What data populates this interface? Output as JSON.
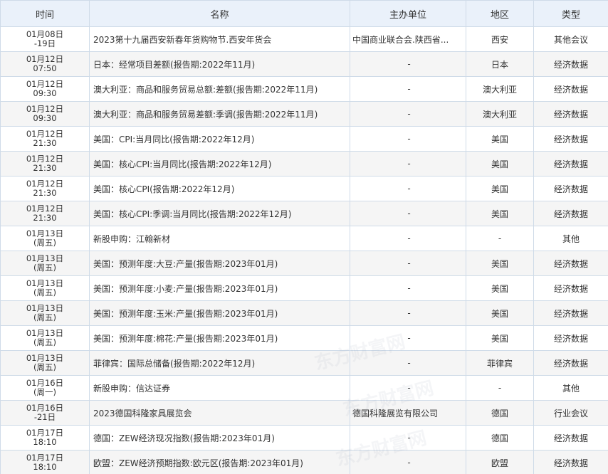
{
  "headers": {
    "time": "时间",
    "name": "名称",
    "organizer": "主办单位",
    "region": "地区",
    "type": "类型"
  },
  "rows": [
    {
      "time1": "01月08日",
      "time2": "-19日",
      "name": "2023第十九届西安新春年货购物节.西安年货会",
      "organizer": "中国商业联合会.陕西省...",
      "region": "西安",
      "type": "其他会议"
    },
    {
      "time1": "01月12日",
      "time2": "07:50",
      "name": "日本：经常项目差额(报告期:2022年11月)",
      "organizer": "-",
      "region": "日本",
      "type": "经济数据"
    },
    {
      "time1": "01月12日",
      "time2": "09:30",
      "name": "澳大利亚：商品和服务贸易总额:差额(报告期:2022年11月)",
      "organizer": "-",
      "region": "澳大利亚",
      "type": "经济数据"
    },
    {
      "time1": "01月12日",
      "time2": "09:30",
      "name": "澳大利亚：商品和服务贸易差额:季调(报告期:2022年11月)",
      "organizer": "-",
      "region": "澳大利亚",
      "type": "经济数据"
    },
    {
      "time1": "01月12日",
      "time2": "21:30",
      "name": "美国：CPI:当月同比(报告期:2022年12月)",
      "organizer": "-",
      "region": "美国",
      "type": "经济数据"
    },
    {
      "time1": "01月12日",
      "time2": "21:30",
      "name": "美国：核心CPI:当月同比(报告期:2022年12月)",
      "organizer": "-",
      "region": "美国",
      "type": "经济数据"
    },
    {
      "time1": "01月12日",
      "time2": "21:30",
      "name": "美国：核心CPI(报告期:2022年12月)",
      "organizer": "-",
      "region": "美国",
      "type": "经济数据"
    },
    {
      "time1": "01月12日",
      "time2": "21:30",
      "name": "美国：核心CPI:季调:当月同比(报告期:2022年12月)",
      "organizer": "-",
      "region": "美国",
      "type": "经济数据"
    },
    {
      "time1": "01月13日",
      "time2": "(周五)",
      "name": "新股申购：江翰新材",
      "organizer": "-",
      "region": "-",
      "type": "其他"
    },
    {
      "time1": "01月13日",
      "time2": "(周五)",
      "name": "美国：预测年度:大豆:产量(报告期:2023年01月)",
      "organizer": "-",
      "region": "美国",
      "type": "经济数据"
    },
    {
      "time1": "01月13日",
      "time2": "(周五)",
      "name": "美国：预测年度:小麦:产量(报告期:2023年01月)",
      "organizer": "-",
      "region": "美国",
      "type": "经济数据"
    },
    {
      "time1": "01月13日",
      "time2": "(周五)",
      "name": "美国：预测年度:玉米:产量(报告期:2023年01月)",
      "organizer": "-",
      "region": "美国",
      "type": "经济数据"
    },
    {
      "time1": "01月13日",
      "time2": "(周五)",
      "name": "美国：预测年度:棉花:产量(报告期:2023年01月)",
      "organizer": "-",
      "region": "美国",
      "type": "经济数据"
    },
    {
      "time1": "01月13日",
      "time2": "(周五)",
      "name": "菲律宾：国际总储备(报告期:2022年12月)",
      "organizer": "-",
      "region": "菲律宾",
      "type": "经济数据"
    },
    {
      "time1": "01月16日",
      "time2": "(周一)",
      "name": "新股申购：信达证券",
      "organizer": "-",
      "region": "-",
      "type": "其他"
    },
    {
      "time1": "01月16日",
      "time2": "-21日",
      "name": "2023德国科隆家具展览会",
      "organizer": "德国科隆展览有限公司",
      "region": "德国",
      "type": "行业会议"
    },
    {
      "time1": "01月17日",
      "time2": "18:10",
      "name": "德国：ZEW经济现况指数(报告期:2023年01月)",
      "organizer": "-",
      "region": "德国",
      "type": "经济数据"
    },
    {
      "time1": "01月17日",
      "time2": "18:10",
      "name": "欧盟：ZEW经济预期指数:欧元区(报告期:2023年01月)",
      "organizer": "-",
      "region": "欧盟",
      "type": "经济数据"
    }
  ]
}
